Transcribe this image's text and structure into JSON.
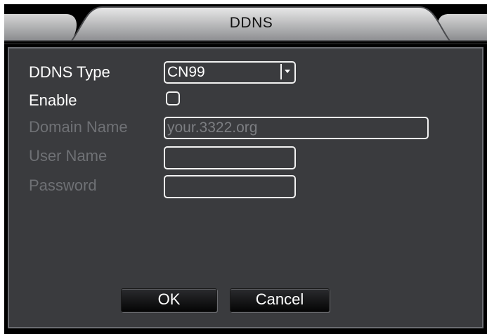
{
  "window": {
    "title": "DDNS"
  },
  "form": {
    "ddns_type": {
      "label": "DDNS Type",
      "value": "CN99"
    },
    "enable": {
      "label": "Enable",
      "checked": false
    },
    "domain_name": {
      "label": "Domain Name",
      "value": "your.3322.org"
    },
    "user_name": {
      "label": "User Name",
      "value": ""
    },
    "password": {
      "label": "Password",
      "value": ""
    }
  },
  "buttons": {
    "ok": "OK",
    "cancel": "Cancel"
  },
  "colors": {
    "panel": "#3a3b3e",
    "frame": "#000000",
    "label_active": "#ffffff",
    "label_disabled": "#6f7175",
    "field_border": "#f2f2f2"
  }
}
